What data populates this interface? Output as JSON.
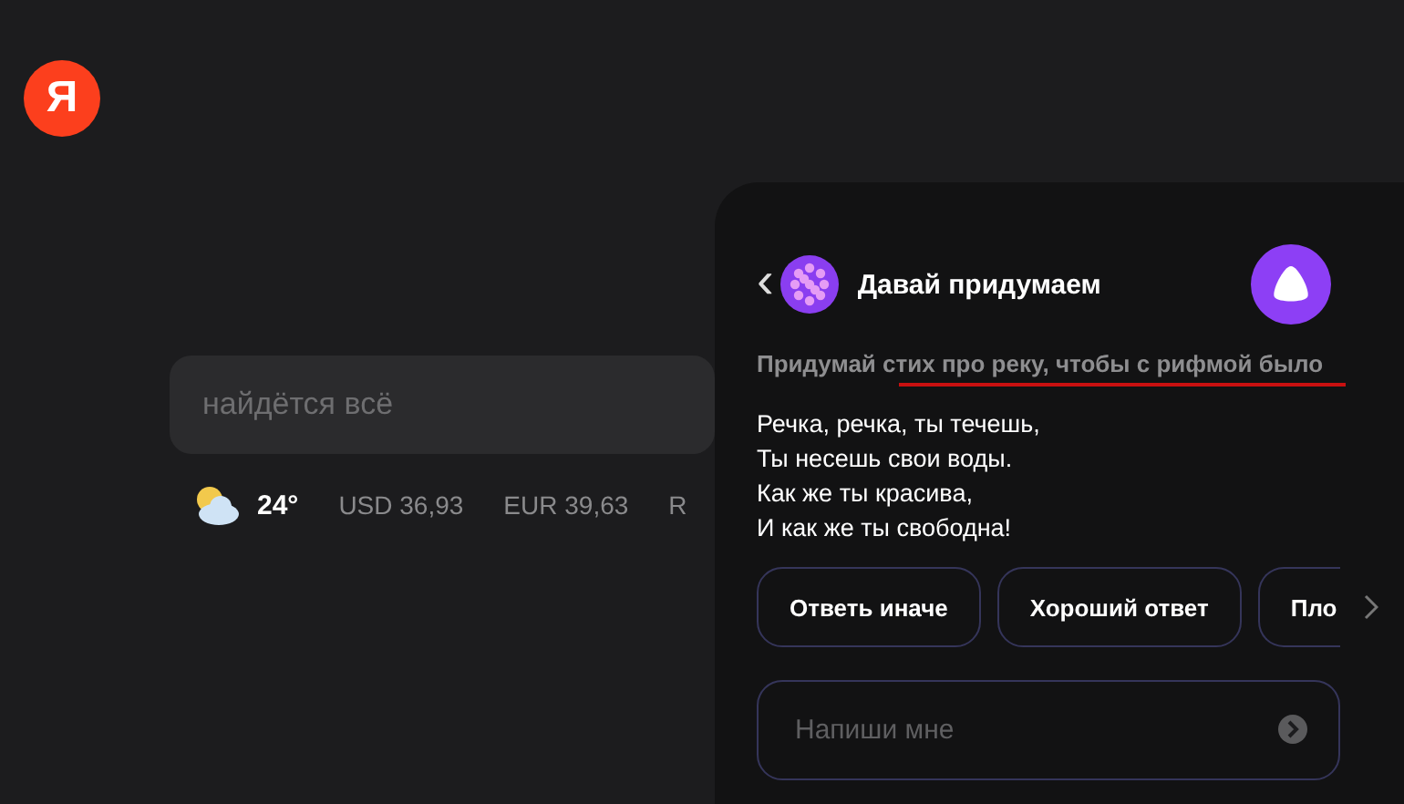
{
  "logo": {
    "letter": "Я"
  },
  "search": {
    "placeholder": "найдётся всё"
  },
  "info_bar": {
    "temperature": "24°",
    "rates": [
      "USD 36,93",
      "EUR 39,63",
      "R"
    ]
  },
  "assistant": {
    "title": "Давай придумаем",
    "back": "‹",
    "prompt": "Придумай стих про реку, чтобы с рифмой было",
    "answer": [
      "Речка, речка, ты течешь,",
      "Ты несешь свои воды.",
      "Как же ты красива,",
      "И как же ты свободна!"
    ],
    "suggestions": [
      "Ответь иначе",
      "Хороший ответ",
      "Пло"
    ],
    "input": {
      "placeholder": "Напиши мне"
    }
  }
}
